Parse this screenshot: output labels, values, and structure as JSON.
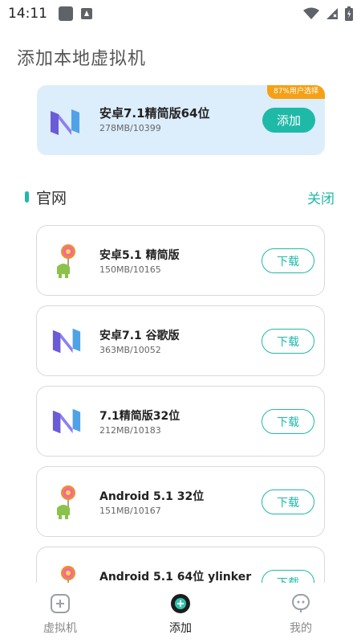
{
  "status_bar": {
    "time": "14:11"
  },
  "page": {
    "title": "添加本地虚拟机"
  },
  "featured": {
    "badge": "87%用户选择",
    "name": "安卓7.1精简版64位",
    "meta": "278MB/10399",
    "button": "添加",
    "icon": "nougat-icon"
  },
  "section": {
    "title": "官网",
    "close": "关闭"
  },
  "items": [
    {
      "name": "安卓5.1 精简版",
      "meta": "150MB/10165",
      "button": "下载",
      "icon": "lollipop-android-icon"
    },
    {
      "name": "安卓7.1 谷歌版",
      "meta": "363MB/10052",
      "button": "下载",
      "icon": "nougat-icon"
    },
    {
      "name": "7.1精简版32位",
      "meta": "212MB/10183",
      "button": "下载",
      "icon": "nougat-icon"
    },
    {
      "name": "Android 5.1 32位",
      "meta": "151MB/10167",
      "button": "下载",
      "icon": "lollipop-android-icon"
    },
    {
      "name": "Android 5.1 64位 ylinker",
      "meta": "",
      "button": "下载",
      "icon": "lollipop-android-icon"
    }
  ],
  "nav": [
    {
      "label": "虚拟机",
      "icon": "virtual-machine-icon"
    },
    {
      "label": "添加",
      "icon": "add-icon"
    },
    {
      "label": "我的",
      "icon": "profile-icon"
    }
  ],
  "colors": {
    "accent": "#1fb9a8",
    "badge": "#f5a015",
    "featured_bg": "#dcedfb"
  }
}
